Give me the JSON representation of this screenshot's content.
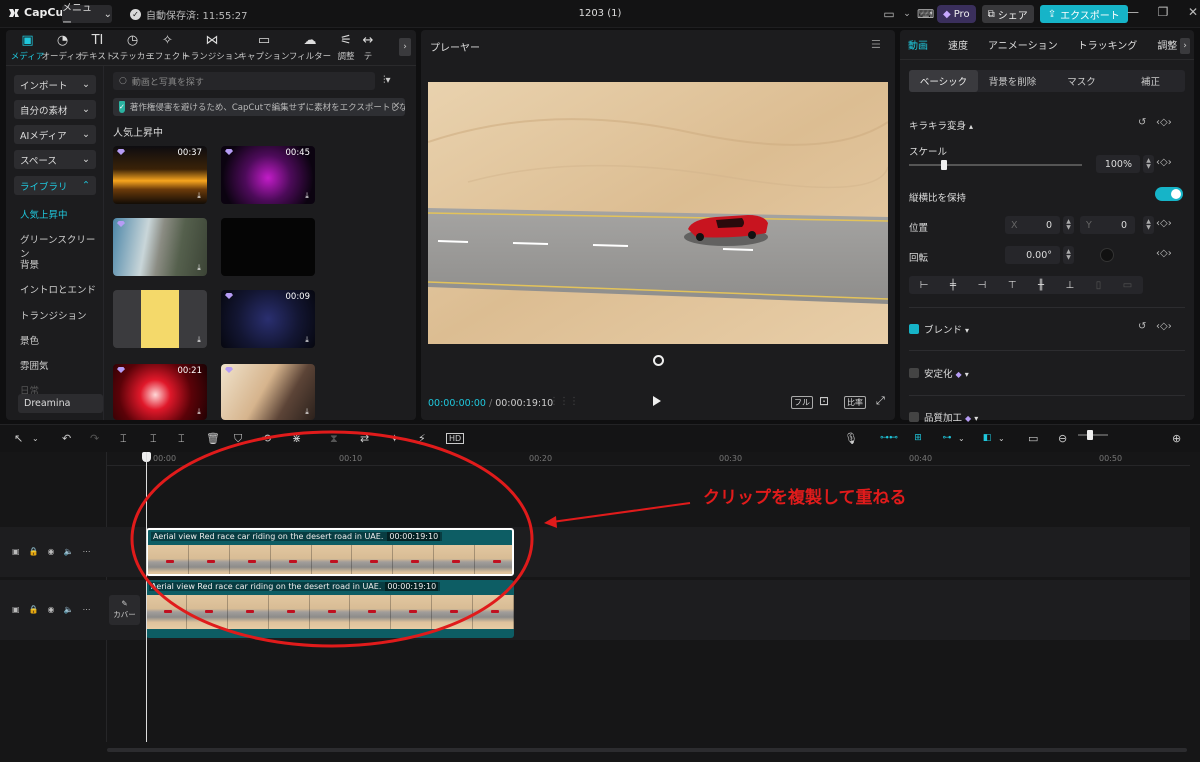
{
  "titlebar": {
    "app_name": "CapCut",
    "menu_label": "メニュー",
    "autosave": "自動保存済: 11:55:27",
    "project_title": "1203 (1)",
    "pro_label": "Pro",
    "share_label": "シェア",
    "export_label": "エクスポート"
  },
  "left_tabs": [
    {
      "label": "メディア",
      "icon": "▣"
    },
    {
      "label": "オーディオ",
      "icon": "◔"
    },
    {
      "label": "テキスト",
      "icon": "TI"
    },
    {
      "label": "ステッカー",
      "icon": "◷"
    },
    {
      "label": "エフェクト",
      "icon": "✧"
    },
    {
      "label": "トランジション",
      "icon": "⋈"
    },
    {
      "label": "キャプション",
      "icon": "▭"
    },
    {
      "label": "フィルター",
      "icon": "☁"
    },
    {
      "label": "調整",
      "icon": "⚟"
    },
    {
      "label": "テ",
      "icon": "↔"
    }
  ],
  "sidebar": {
    "buttons": [
      "インポート",
      "自分の素材",
      "AIメディア",
      "スペース",
      "ライブラリ"
    ],
    "sub_items": [
      "人気上昇中",
      "グリーンスクリーン",
      "背景",
      "イントロとエンド",
      "トランジション",
      "景色",
      "雰囲気",
      "日常"
    ],
    "dreamina": "Dreamina"
  },
  "media": {
    "search_placeholder": "動画と写真を探す",
    "notice": "著作権侵害を避けるため、CapCutで編集せずに素材をエクスポートしない",
    "section_title": "人気上昇中",
    "thumbs": [
      {
        "dur": "00:37"
      },
      {
        "dur": "00:45"
      },
      {
        "dur": ""
      },
      {
        "dur": ""
      },
      {
        "dur": ""
      },
      {
        "dur": "00:09"
      },
      {
        "dur": "00:21"
      },
      {
        "dur": ""
      }
    ]
  },
  "player": {
    "title": "プレーヤー",
    "current": "00:00:00:00",
    "total": "00:00:19:10",
    "ctl_full": "フル",
    "ctl_ratio": "比率"
  },
  "props": {
    "tabs": [
      "動画",
      "速度",
      "アニメーション",
      "トラッキング",
      "調整"
    ],
    "subtabs": [
      "ベーシック",
      "背景を削除",
      "マスク",
      "補正"
    ],
    "transform": "キラキラ変身",
    "scale_label": "スケール",
    "scale_value": "100%",
    "aspect_lock": "縦横比を保持",
    "position_label": "位置",
    "pos_x_label": "X",
    "pos_x": "0",
    "pos_y_label": "Y",
    "pos_y": "0",
    "rotate_label": "回転",
    "rotate_value": "0.00°",
    "blend": "ブレンド",
    "stabilize": "安定化",
    "quality": "品質加工",
    "aspect_lock_on": true,
    "scale_fraction": 0.2
  },
  "timeline": {
    "ruler": [
      "00:00",
      "00:10",
      "00:20",
      "00:30",
      "00:40",
      "00:50"
    ],
    "clip_title": "Aerial view Red race car riding on the desert road in UAE.",
    "clip_tc": "00:00:19:10",
    "cover_label": "カバー",
    "annotation": "クリップを複製して重ねる"
  },
  "colors": {
    "accent": "#1fc7dc",
    "annotation": "#e01b1b"
  }
}
